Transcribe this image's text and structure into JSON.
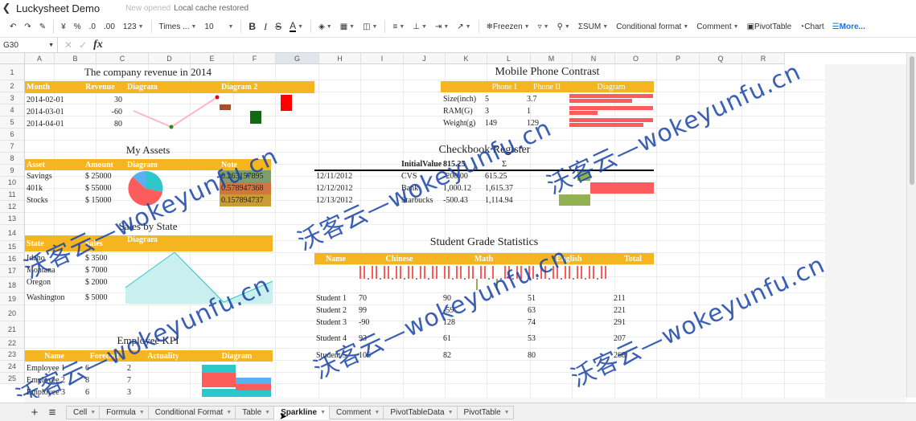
{
  "app": {
    "title": "Luckysheet Demo",
    "status_prefix": "New opened",
    "status_text": "Local cache restored"
  },
  "toolbar": {
    "font_family": "Times ...",
    "font_size": "10",
    "number_format": "123",
    "freeze": "Freezen",
    "sum": "SUM",
    "conditional_format": "Conditional format",
    "comment": "Comment",
    "pivot_table": "PivotTable",
    "chart": "Chart",
    "more": "More..."
  },
  "formula_bar": {
    "cell_ref": "G30"
  },
  "columns": [
    "A",
    "B",
    "C",
    "D",
    "E",
    "F",
    "G",
    "H",
    "I",
    "J",
    "K",
    "L",
    "M",
    "N",
    "O",
    "P",
    "Q",
    "R"
  ],
  "rows": [
    "1",
    "2",
    "3",
    "4",
    "5",
    "6",
    "7",
    "8",
    "9",
    "10",
    "11",
    "12",
    "13",
    "14",
    "15",
    "16",
    "17",
    "18",
    "19",
    "20",
    "21",
    "22",
    "23",
    "24",
    "25"
  ],
  "revenue": {
    "title": "The company revenue in 2014",
    "headers": [
      "Month",
      "Revenue",
      "Diagram",
      "Diagram 2"
    ],
    "rows": [
      {
        "month": "2014-02-01",
        "value": "30"
      },
      {
        "month": "2014-03-01",
        "value": "-60"
      },
      {
        "month": "2014-04-01",
        "value": "80"
      }
    ]
  },
  "assets": {
    "title": "My Assets",
    "headers": [
      "Asset",
      "Amount",
      "Diagram",
      "Note"
    ],
    "rows": [
      {
        "asset": "Savings",
        "amount": "$ 25000",
        "note": "0.263157895"
      },
      {
        "asset": "401k",
        "amount": "$ 55000",
        "note": "0.578947368"
      },
      {
        "asset": "Stocks",
        "amount": "$ 15000",
        "note": "0.157894737"
      }
    ]
  },
  "sales": {
    "title": "Sales by State",
    "headers": [
      "State",
      "Sales",
      "Diagram"
    ],
    "rows": [
      {
        "state": "Idaho",
        "sales": "$ 3500"
      },
      {
        "state": "Montana",
        "sales": "$ 7000"
      },
      {
        "state": "Oregon",
        "sales": "$ 2000"
      },
      {
        "state": "Washington",
        "sales": "$ 5000"
      }
    ]
  },
  "kpi": {
    "title": "Employee KPI",
    "headers": [
      "Name",
      "Forecast",
      "Actuality",
      "Diagram"
    ],
    "rows": [
      {
        "name": "Employee 1",
        "forecast": "6",
        "actual": "2"
      },
      {
        "name": "Employee 2",
        "forecast": "8",
        "actual": "7"
      },
      {
        "name": "Employee 3",
        "forecast": "6",
        "actual": "3"
      }
    ]
  },
  "phone": {
    "title": "Mobile Phone Contrast",
    "headers": [
      "Phone I",
      "Phone II",
      "Diagram"
    ],
    "rows": [
      {
        "label": "Size(inch)",
        "a": "5",
        "b": "3.7"
      },
      {
        "label": "RAM(G)",
        "a": "3",
        "b": "1"
      },
      {
        "label": "Weight(g)",
        "a": "149",
        "b": "129"
      }
    ]
  },
  "checkbook": {
    "title": "Checkbook Register",
    "header_label": "InitialValue",
    "header_value": "815.25",
    "header_sigma": "Σ",
    "rows": [
      {
        "date": "12/11/2012",
        "payee": "CVS",
        "amount": "-200.00",
        "balance": "615.25"
      },
      {
        "date": "12/12/2012",
        "payee": "Bank",
        "amount": "1,000.12",
        "balance": "1,615.37"
      },
      {
        "date": "12/13/2012",
        "payee": "Starbucks",
        "amount": "-500.43",
        "balance": "1,114.94"
      }
    ]
  },
  "grades": {
    "title": "Student Grade Statistics",
    "headers": [
      "Name",
      "Chinese",
      "Math",
      "English",
      "Total"
    ],
    "rows": [
      {
        "name": "Student 1",
        "chinese": "70",
        "math": "90",
        "english": "51",
        "total": "211"
      },
      {
        "name": "Student 2",
        "chinese": "99",
        "math": "-59",
        "english": "63",
        "total": "221"
      },
      {
        "name": "Student 3",
        "chinese": "-90",
        "math": "128",
        "english": "74",
        "total": "291"
      },
      {
        "name": "Student 4",
        "chinese": "93",
        "math": "61",
        "english": "53",
        "total": "207"
      },
      {
        "name": "Student 5",
        "chinese": "106",
        "math": "82",
        "english": "80",
        "total": "268"
      }
    ]
  },
  "sheets": [
    "Cell",
    "Formula",
    "Conditional Format",
    "Table",
    "Sparkline",
    "Comment",
    "PivotTableData",
    "PivotTable"
  ],
  "active_sheet": "Sparkline",
  "watermark": "沃客云—wokeyunfu.cn",
  "colors": {
    "header": "#f4b521",
    "red": "#fc5c5c",
    "green": "#2a8c2a",
    "teal": "#2ec7c9",
    "line": "#ffb6c1"
  }
}
